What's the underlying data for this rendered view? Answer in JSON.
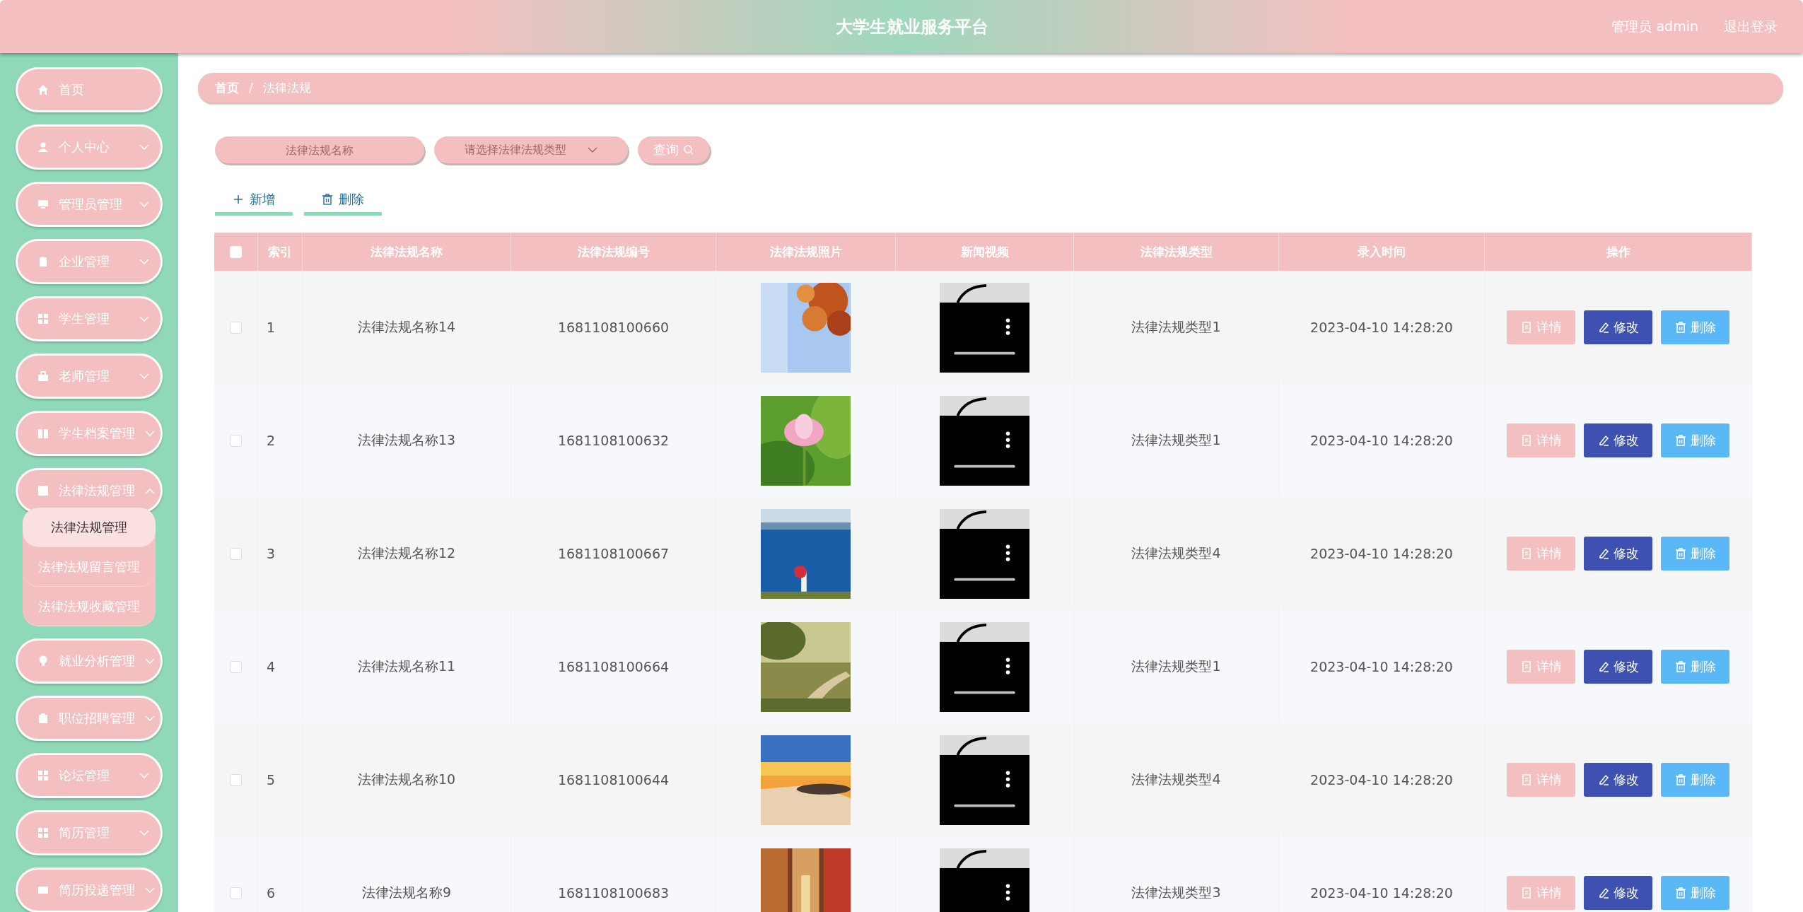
{
  "header": {
    "title": "大学生就业服务平台",
    "user": "管理员 admin",
    "logout": "退出登录"
  },
  "sidebar": {
    "items": [
      {
        "label": "首页",
        "kind": "link"
      },
      {
        "label": "个人中心",
        "kind": "menu",
        "expanded": false
      },
      {
        "label": "管理员管理",
        "kind": "menu",
        "expanded": false
      },
      {
        "label": "企业管理",
        "kind": "menu",
        "expanded": false
      },
      {
        "label": "学生管理",
        "kind": "menu",
        "expanded": false
      },
      {
        "label": "老师管理",
        "kind": "menu",
        "expanded": false
      },
      {
        "label": "学生档案管理",
        "kind": "menu",
        "expanded": false
      },
      {
        "label": "法律法规管理",
        "kind": "menu",
        "expanded": true,
        "children": [
          {
            "label": "法律法规管理",
            "selected": true
          },
          {
            "label": "法律法规留言管理",
            "selected": false
          },
          {
            "label": "法律法规收藏管理",
            "selected": false
          }
        ]
      },
      {
        "label": "就业分析管理",
        "kind": "menu",
        "expanded": false
      },
      {
        "label": "职位招聘管理",
        "kind": "menu",
        "expanded": false
      },
      {
        "label": "论坛管理",
        "kind": "menu",
        "expanded": false
      },
      {
        "label": "简历管理",
        "kind": "menu",
        "expanded": false
      },
      {
        "label": "简历投递管理",
        "kind": "menu",
        "expanded": false
      }
    ]
  },
  "breadcrumb": {
    "items": [
      "首页",
      "法律法规"
    ],
    "separator": "/"
  },
  "search": {
    "name_field": {
      "placeholder": "法律法规名称"
    },
    "type_select": {
      "placeholder": "请选择法律法规类型"
    },
    "button": "查询"
  },
  "actions": [
    {
      "label": "新增",
      "kind": "add"
    },
    {
      "label": "删除",
      "kind": "delete"
    }
  ],
  "table": {
    "select_all": {
      "checked": false
    },
    "columns": [
      "索引",
      "法律法规名称",
      "法律法规编号",
      "法律法规照片",
      "新闻视频",
      "法律法规类型",
      "录入时间",
      "操作"
    ],
    "rows": [
      {
        "checked": false,
        "index": "1",
        "name": "法律法规名称14",
        "code": "1681108100660",
        "type": "法律法规类型1",
        "time": "2023-04-10 14:28:20",
        "buttons": [
          "详情",
          "修改",
          "删除"
        ]
      },
      {
        "checked": false,
        "index": "2",
        "name": "法律法规名称13",
        "code": "1681108100632",
        "type": "法律法规类型1",
        "time": "2023-04-10 14:28:20",
        "buttons": [
          "详情",
          "修改",
          "删除"
        ]
      },
      {
        "checked": false,
        "index": "3",
        "name": "法律法规名称12",
        "code": "1681108100667",
        "type": "法律法规类型4",
        "time": "2023-04-10 14:28:20",
        "buttons": [
          "详情",
          "修改",
          "删除"
        ]
      },
      {
        "checked": false,
        "index": "4",
        "name": "法律法规名称11",
        "code": "1681108100664",
        "type": "法律法规类型1",
        "time": "2023-04-10 14:28:20",
        "buttons": [
          "详情",
          "修改",
          "删除"
        ]
      },
      {
        "checked": false,
        "index": "5",
        "name": "法律法规名称10",
        "code": "1681108100644",
        "type": "法律法规类型4",
        "time": "2023-04-10 14:28:20",
        "buttons": [
          "详情",
          "修改",
          "删除"
        ]
      },
      {
        "checked": false,
        "index": "6",
        "name": "法律法规名称9",
        "code": "1681108100683",
        "type": "法律法规类型3",
        "time": "2023-04-10 14:28:20",
        "buttons": [
          "详情",
          "修改",
          "删除"
        ]
      }
    ]
  }
}
